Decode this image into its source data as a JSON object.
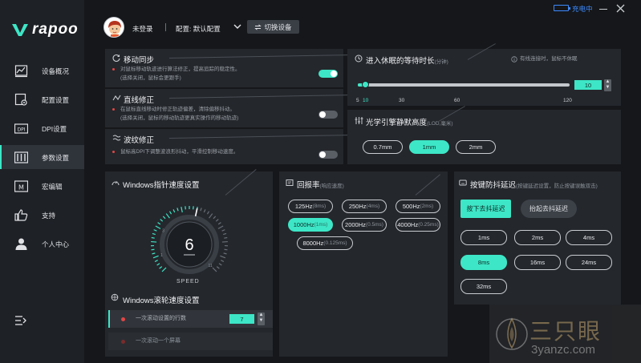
{
  "brand": {
    "logo": "rapoo"
  },
  "topbar": {
    "login_status": "未登录",
    "config_label": "配置: 默认配置",
    "switch_device": "切换设备",
    "battery_status": "充电中"
  },
  "sidebar": {
    "items": [
      {
        "label": "设备概况",
        "icon": "chart-icon"
      },
      {
        "label": "配置设置",
        "icon": "config-icon"
      },
      {
        "label": "DPI设置",
        "icon": "dpi-icon"
      },
      {
        "label": "参数设置",
        "icon": "params-icon",
        "active": true
      },
      {
        "label": "宏编辑",
        "icon": "macro-icon"
      },
      {
        "label": "支持",
        "icon": "thumbs-up-icon"
      },
      {
        "label": "个人中心",
        "icon": "user-icon"
      }
    ]
  },
  "motion_sync": {
    "title": "移动同步",
    "desc_1": "对鼠标移动轨迹进行算法修正，提高追踪的稳定性。",
    "desc_2": "(选择关闭，鼠标会更跟手)",
    "enabled": true
  },
  "angle_snap": {
    "title": "直线修正",
    "desc_1": "在鼠标直线移动时修正轨迹偏差，清除偏移抖动。",
    "desc_2": "(选择关闭，鼠标的移动轨迹更真实操作的移动轨迹)",
    "enabled": false
  },
  "ripple": {
    "title": "波纹修正",
    "desc_1": "鼠标高DPI下调整波浪形抖动，平滑控制移动速度。",
    "enabled": false
  },
  "sleep": {
    "title": "进入休眠的等待时长",
    "unit": "(分钟)",
    "note": "有线连接时，鼠标不休眠",
    "value": "10",
    "value_num": 10,
    "ticks": [
      "5",
      "10",
      "30",
      "60",
      "120"
    ]
  },
  "lod": {
    "title": "光学引擎静默高度",
    "unit": "(LOD,毫米)",
    "options": [
      "0.7mm",
      "1mm",
      "2mm"
    ],
    "selected": "1mm"
  },
  "pointer_speed": {
    "title": "Windows指针速度设置",
    "value": "6",
    "value_num": 6,
    "max": 11,
    "speed_label": "SPEED",
    "scale_1": "1",
    "scale_3": "3",
    "scale_11": "11"
  },
  "scroll_speed": {
    "title": "Windows滚轮速度设置",
    "option_lines": "一次滚动设置的行数",
    "lines_value": "7",
    "option_screen": "一次滚动一个屏幕"
  },
  "polling_rate": {
    "title": "回报率",
    "unit": "(响应速度)",
    "options": [
      {
        "rate": "125Hz",
        "ms": "(8ms)"
      },
      {
        "rate": "250Hz",
        "ms": "(4ms)"
      },
      {
        "rate": "500Hz",
        "ms": "(2ms)"
      },
      {
        "rate": "1000Hz",
        "ms": "(1ms)"
      },
      {
        "rate": "2000Hz",
        "ms": "(0.5ms)"
      },
      {
        "rate": "4000Hz",
        "ms": "(0.25ms)"
      },
      {
        "rate": "8000Hz",
        "ms": "(0.125ms)"
      }
    ],
    "selected_index": 3
  },
  "debounce": {
    "title": "按键防抖延迟",
    "unit": "(按键延迟设置，防止按键误触双击)",
    "tab_press": "按下去抖延迟",
    "tab_release": "抬起去抖延迟",
    "options": [
      "1ms",
      "2ms",
      "4ms",
      "8ms",
      "16ms",
      "24ms",
      "32ms"
    ],
    "selected": "8ms"
  },
  "watermark": {
    "brand": "三只眼",
    "url": "3yanzc.com"
  },
  "colors": {
    "accent": "#3de6c6",
    "panel": "#24272c",
    "background": "#15171a",
    "sidebar": "#1e2126"
  }
}
